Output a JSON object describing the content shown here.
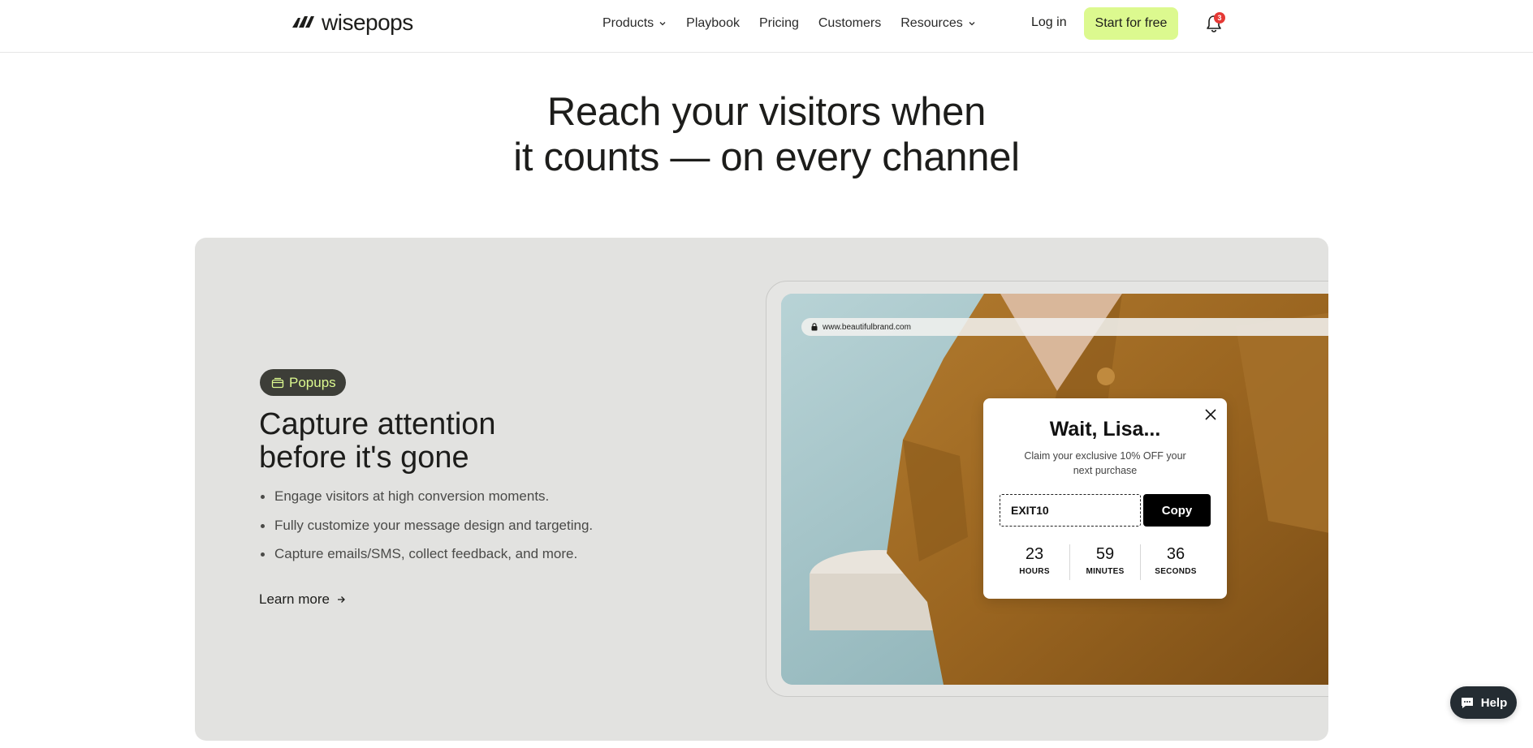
{
  "brand": {
    "name": "wisepops",
    "accent": "#dcf98f"
  },
  "nav": {
    "items": [
      {
        "label": "Products",
        "dropdown": true
      },
      {
        "label": "Playbook",
        "dropdown": false
      },
      {
        "label": "Pricing",
        "dropdown": false
      },
      {
        "label": "Customers",
        "dropdown": false
      },
      {
        "label": "Resources",
        "dropdown": true
      }
    ],
    "login": "Log in",
    "cta": "Start for free",
    "notifications_count": "3"
  },
  "hero": {
    "line1": "Reach your visitors when",
    "line2": "it counts — on every channel"
  },
  "feature": {
    "badge": "Popups",
    "title_line1": "Capture attention",
    "title_line2": "before it's gone",
    "bullets": [
      "Engage visitors at high conversion moments.",
      "Fully customize your message design and targeting.",
      "Capture emails/SMS, collect feedback, and more."
    ],
    "learn_more": "Learn more"
  },
  "mockup": {
    "url": "www.beautifulbrand.com",
    "popup": {
      "title": "Wait, Lisa...",
      "subtitle": "Claim your exclusive 10% OFF your next purchase",
      "coupon_code": "EXIT10",
      "copy_label": "Copy",
      "timer": [
        {
          "value": "23",
          "label": "HOURS"
        },
        {
          "value": "59",
          "label": "MINUTES"
        },
        {
          "value": "36",
          "label": "SECONDS"
        }
      ]
    }
  },
  "help": {
    "label": "Help"
  }
}
